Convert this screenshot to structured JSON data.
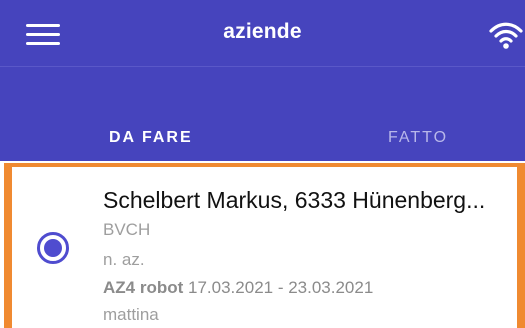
{
  "header": {
    "title": "aziende",
    "menu_icon": "hamburger-icon",
    "wifi_icon": "wifi-icon"
  },
  "tabs": [
    {
      "label": "DA FARE",
      "active": true
    },
    {
      "label": "FATTO",
      "active": false
    }
  ],
  "item": {
    "name": "Schelbert Markus, 6333 Hünenberg...",
    "org": "BVCH",
    "id_label": "n. az.",
    "robot_label": "AZ4 robot",
    "date_range": "17.03.2021 - 23.03.2021",
    "time_of_day": "mattina",
    "selected": true
  },
  "colors": {
    "header_bg": "#4644bd",
    "accent_orange": "#f08a31",
    "radio": "#4f4ccf"
  }
}
